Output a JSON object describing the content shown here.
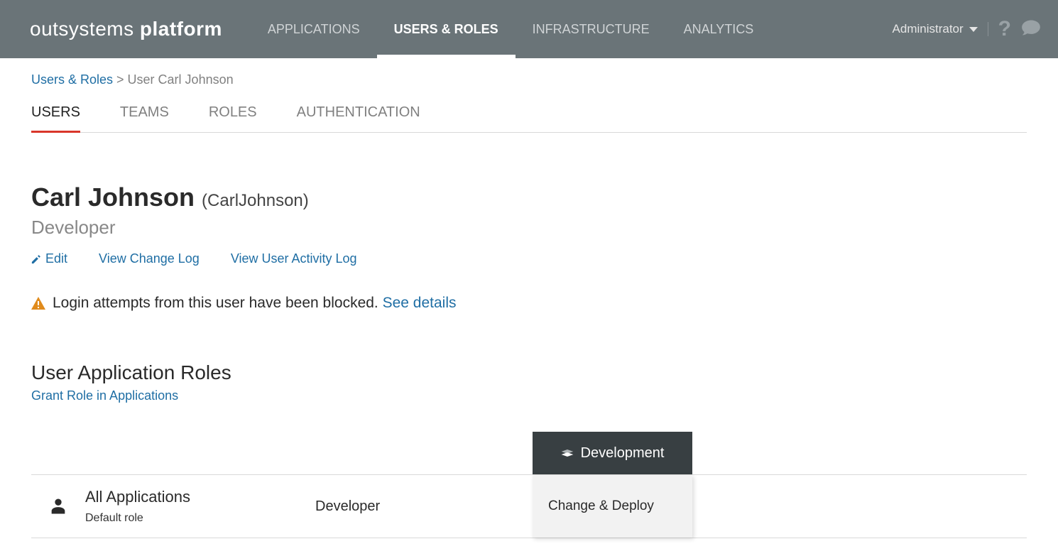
{
  "header": {
    "logo_light": "outsystems",
    "logo_bold": "platform",
    "nav": [
      "APPLICATIONS",
      "USERS & ROLES",
      "INFRASTRUCTURE",
      "ANALYTICS"
    ],
    "user": "Administrator"
  },
  "breadcrumb": {
    "link": "Users & Roles",
    "separator": " > ",
    "current": "User Carl Johnson"
  },
  "sub_tabs": [
    "USERS",
    "TEAMS",
    "ROLES",
    "AUTHENTICATION"
  ],
  "user": {
    "display_name": "Carl Johnson",
    "username": "(CarlJohnson)",
    "role": "Developer"
  },
  "actions": {
    "edit": "Edit",
    "change_log": "View Change Log",
    "activity_log": "View User Activity Log"
  },
  "alert": {
    "text": "Login attempts from this user have been blocked. ",
    "link": "See details"
  },
  "section": {
    "title": "User Application Roles",
    "grant": "Grant Role in Applications"
  },
  "table": {
    "env_header": "Development",
    "row": {
      "app": "All Applications",
      "sub": "Default role",
      "role": "Developer",
      "env_value": "Change & Deploy"
    }
  }
}
